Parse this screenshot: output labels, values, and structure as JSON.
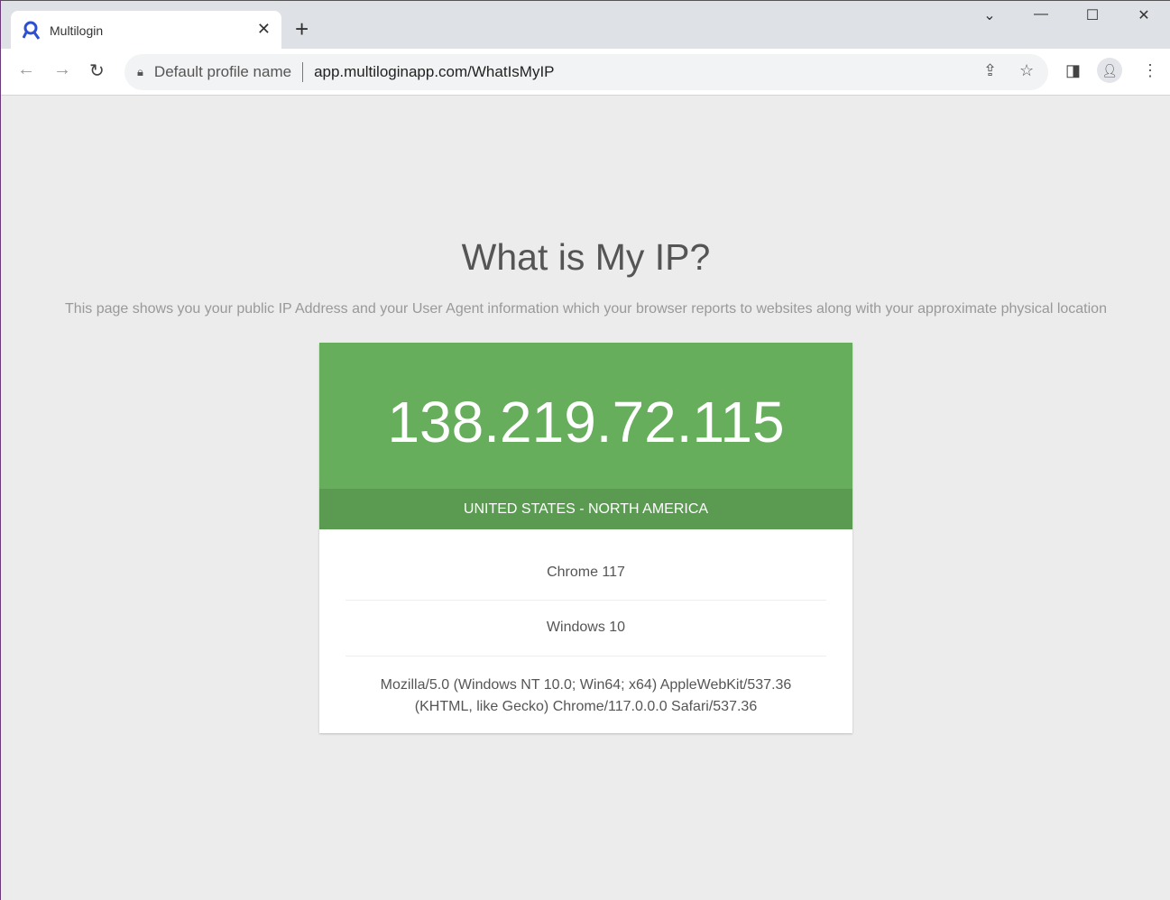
{
  "browser": {
    "tab_title": "Multilogin",
    "profile_name": "Default profile name",
    "url": "app.multiloginapp.com/WhatIsMyIP"
  },
  "page": {
    "title": "What is My IP?",
    "subtitle": "This page shows you your public IP Address and your User Agent information which your browser reports to websites along with your approximate physical location",
    "ip": "138.219.72.115",
    "location": "UNITED STATES - NORTH AMERICA",
    "browser": "Chrome 117",
    "os": "Windows 10",
    "user_agent": "Mozilla/5.0 (Windows NT 10.0; Win64; x64) AppleWebKit/537.36 (KHTML, like Gecko) Chrome/117.0.0.0 Safari/537.36"
  },
  "colors": {
    "green": "#66ad5c",
    "green_dark": "#5a9b51"
  }
}
